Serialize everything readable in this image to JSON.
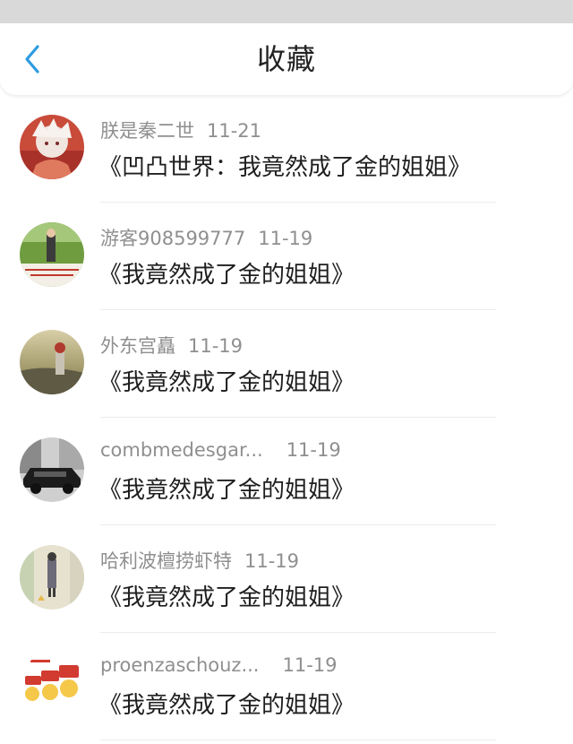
{
  "header": {
    "title": "收藏",
    "back_icon": "chevron-left-icon",
    "accent_color": "#2c9be0"
  },
  "favorites": [
    {
      "user": "朕是秦二世",
      "date": "11-21",
      "book": "《凹凸世界：我竟然成了金的姐姐》"
    },
    {
      "user": "游客908599777",
      "date": "11-19",
      "book": "《我竟然成了金的姐姐》"
    },
    {
      "user": "外东宫矗",
      "date": "11-19",
      "book": "《我竟然成了金的姐姐》"
    },
    {
      "user": "combmedesgar...",
      "date": "11-19",
      "book": "《我竟然成了金的姐姐》"
    },
    {
      "user": "哈利波檀捞虾特",
      "date": "11-19",
      "book": "《我竟然成了金的姐姐》"
    },
    {
      "user": "proenzaschouz...",
      "date": "11-19",
      "book": "《我竟然成了金的姐姐》"
    }
  ]
}
